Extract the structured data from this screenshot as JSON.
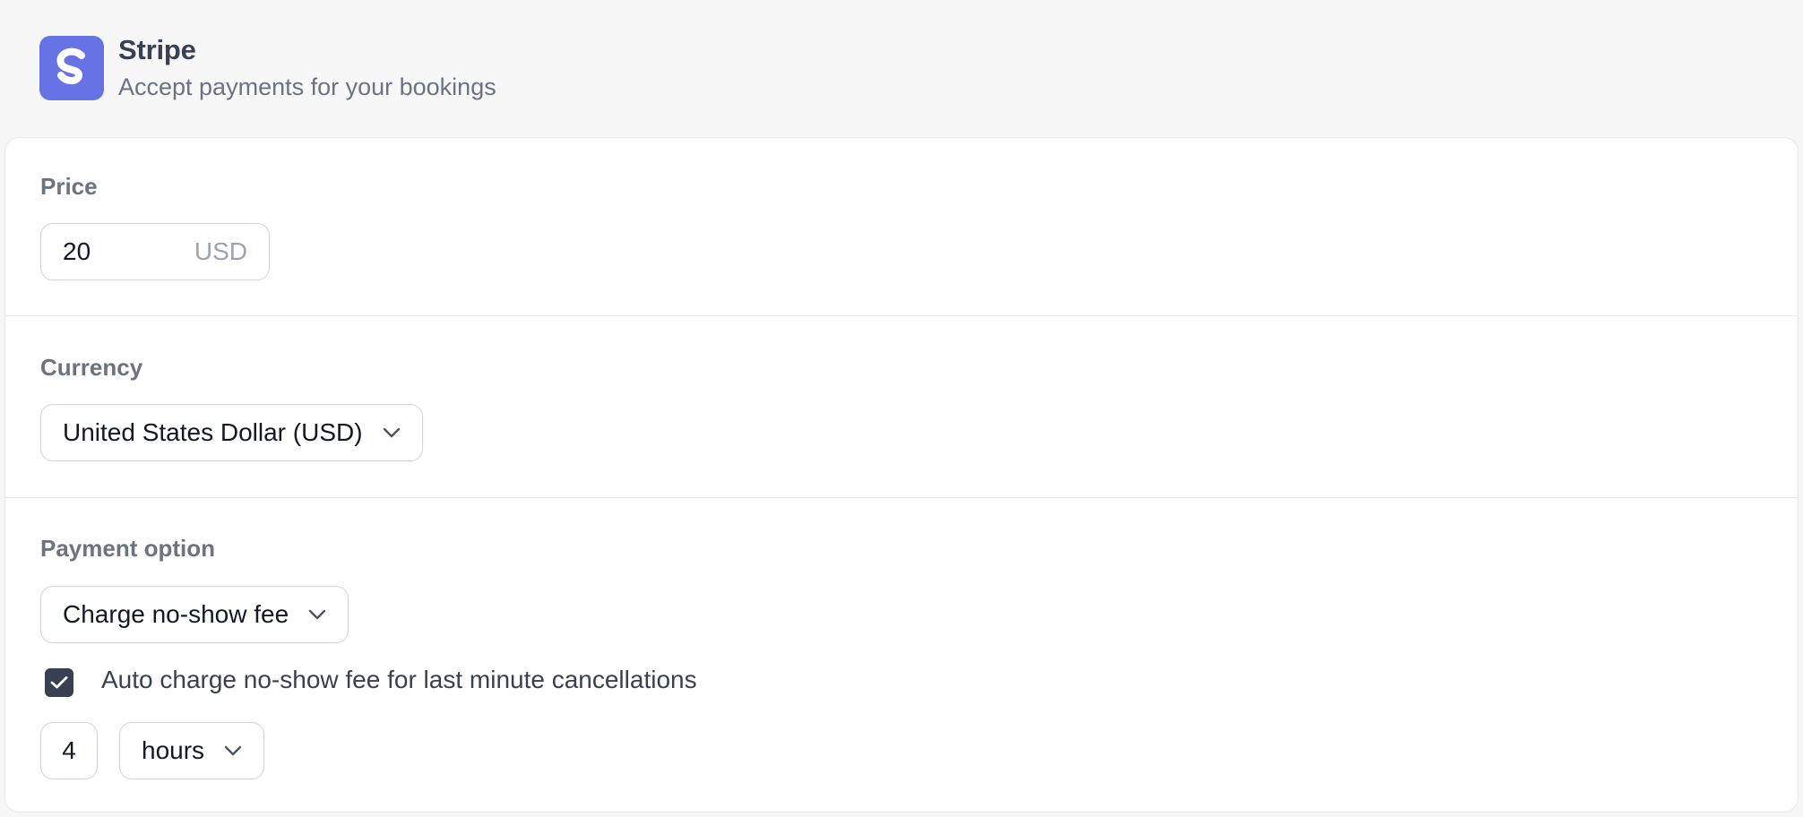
{
  "app": {
    "logo_letter": "S",
    "title": "Stripe",
    "description": "Accept payments for your bookings",
    "brand_color": "#6772e5"
  },
  "price": {
    "label": "Price",
    "value": "20",
    "suffix": "USD"
  },
  "currency": {
    "label": "Currency",
    "selected": "United States Dollar (USD)"
  },
  "payment_option": {
    "label": "Payment option",
    "selected": "Charge no-show fee",
    "auto_charge": {
      "checked": true,
      "label": "Auto charge no-show fee for last minute cancellations"
    },
    "time_value": "4",
    "time_unit": "hours"
  },
  "icons": {
    "dropdown": "chevron-down-icon",
    "checkbox": "check-icon"
  }
}
